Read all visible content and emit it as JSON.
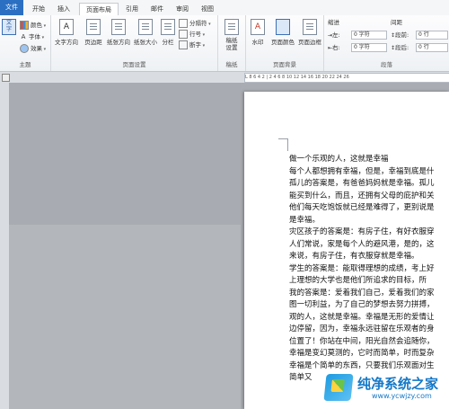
{
  "tabs": [
    "文件",
    "开始",
    "插入",
    "页面布局",
    "引用",
    "邮件",
    "审阅",
    "视图"
  ],
  "active_tab": "页面布局",
  "ribbon": {
    "theme_group": {
      "label": "主题",
      "big_button": "文\n字",
      "small": [
        "颜色",
        "字体",
        "效果"
      ]
    },
    "page_setup": {
      "label": "页面设置",
      "buttons": [
        "文字方向",
        "页边距",
        "纸张方向",
        "纸张大小",
        "分栏"
      ],
      "small": [
        "分隔符",
        "行号",
        "断字"
      ]
    },
    "draft": {
      "label": "稿纸",
      "button": "稿纸\n设置"
    },
    "background": {
      "label": "页面背景",
      "buttons": [
        "水印",
        "页面颜色",
        "页面边框"
      ]
    },
    "paragraph": {
      "label": "段落",
      "indent_title": "缩进",
      "spacing_title": "间距",
      "left_label": "左:",
      "right_label": "右:",
      "before_label": "段前:",
      "after_label": "段后:",
      "left_value": "0 字符",
      "right_value": "0 字符",
      "before_value": "0 行",
      "after_value": "0 行"
    }
  },
  "ruler": "L 8 6 4 2 | 2 4 6 8 10 12 14 16 18 20 22 24 26",
  "document": {
    "lines": [
      "做一个乐观的人，这就是幸福",
      "每个人都想拥有幸福，但是，幸福到底是什",
      "孤儿的答案是，有爸爸妈妈就是幸福。孤儿",
      "能买到什么，而且，还拥有父母的庇护和关",
      "他们每天吃饱饭就已经是难得了，更别说是",
      "是幸福。",
      "灾区孩子的答案是：有房子住，有好衣服穿",
      "人们常说，家是每个人的避风港，是的，这",
      "来说，有房子住，有衣服穿就是幸福。",
      "学生的答案是：能取得理想的成绩，考上好",
      "上理想的大学也是他们所追求的目标，所",
      "我的答案是：爱着我们自己，爱着我们的家",
      "图一切利益，为了自己的梦想去努力拼搏，",
      "观的人，这就是幸福。幸福是无形的爱情让",
      "边停留，因为，幸福永远驻留在乐观者的身",
      "位置了！你站在中间，阳光自然会追随你，",
      "幸福是变幻莫测的，它时而简单，时而复杂",
      "幸福是个简单的东西，只要我们乐观面对生",
      "简单又"
    ]
  },
  "watermark": {
    "title": "纯净系统之家",
    "url": "www.ycwjzy.com"
  }
}
